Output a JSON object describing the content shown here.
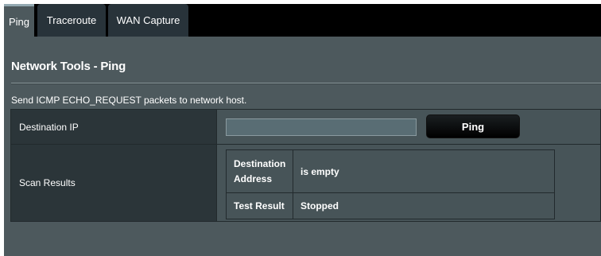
{
  "tabs": [
    {
      "label": "Ping",
      "active": true
    },
    {
      "label": "Traceroute",
      "active": false
    },
    {
      "label": "WAN Capture",
      "active": false
    }
  ],
  "page": {
    "title": "Network Tools - Ping",
    "description": "Send ICMP ECHO_REQUEST packets to network host."
  },
  "form": {
    "destination_ip": {
      "label": "Destination IP",
      "value": "",
      "button_label": "Ping"
    },
    "scan_results": {
      "label": "Scan Results",
      "rows": [
        {
          "label": "Destination Address",
          "value": "is empty"
        },
        {
          "label": "Test Result",
          "value": "Stopped"
        }
      ]
    }
  },
  "colors": {
    "panel_bg": "#4d595d",
    "label_bg": "#2b3539",
    "tab_bar_bg": "#000000",
    "button_bg": "#000000"
  }
}
